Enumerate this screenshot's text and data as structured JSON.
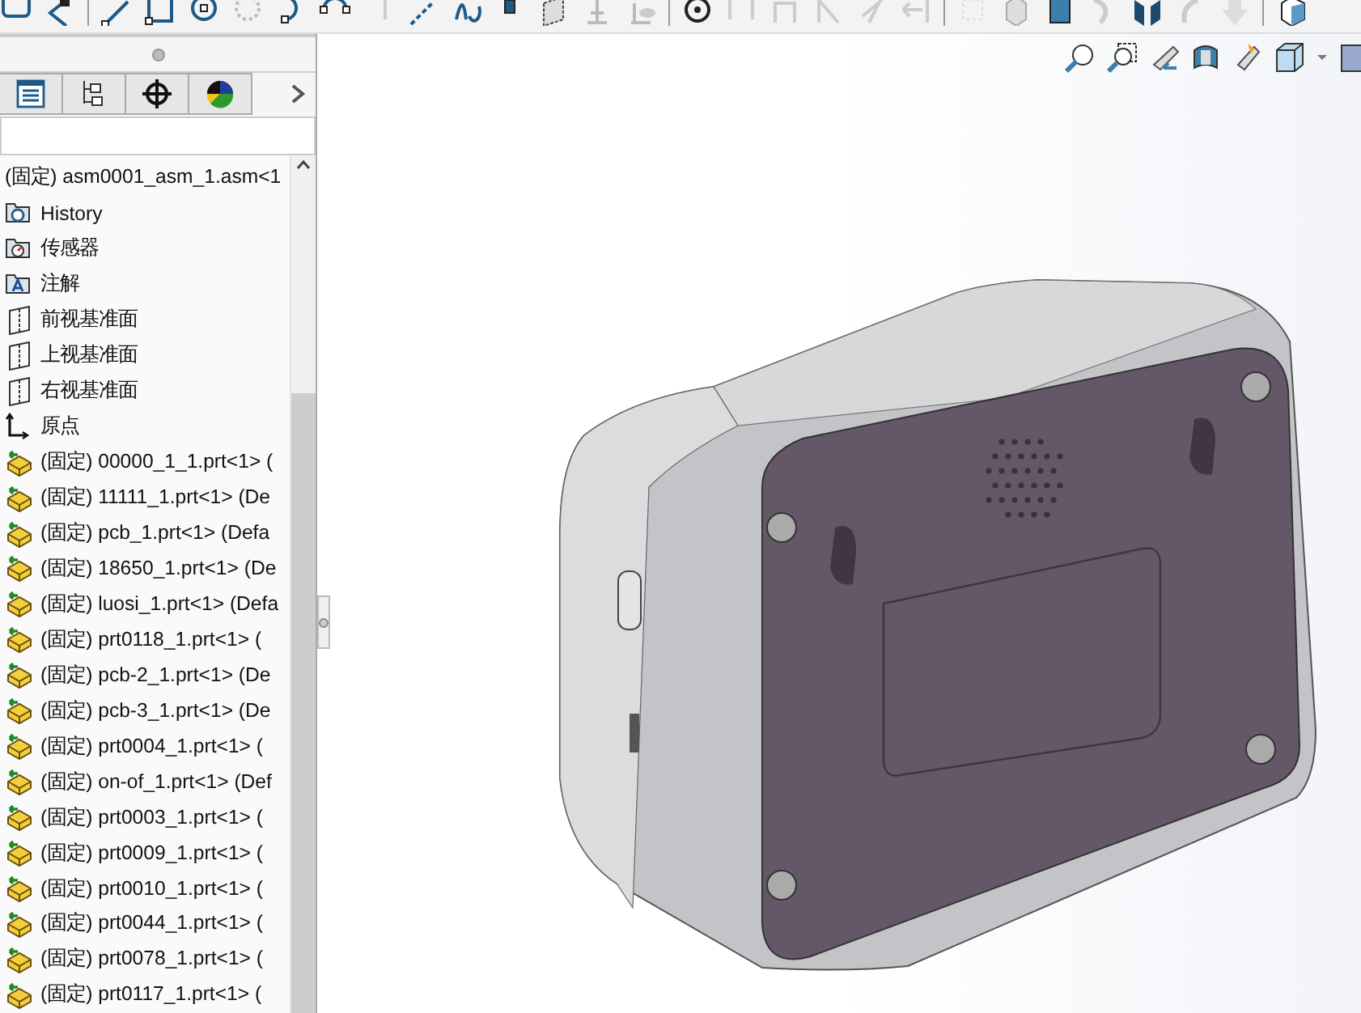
{
  "tree": {
    "items": [
      {
        "kind": "root",
        "label": "(固定) asm0001_asm_1.asm<1"
      },
      {
        "kind": "history",
        "label": "History"
      },
      {
        "kind": "sensor",
        "label": "传感器"
      },
      {
        "kind": "annotation",
        "label": "注解"
      },
      {
        "kind": "plane",
        "label": "前视基准面"
      },
      {
        "kind": "plane",
        "label": "上视基准面"
      },
      {
        "kind": "plane",
        "label": "右视基准面"
      },
      {
        "kind": "origin",
        "label": "原点"
      },
      {
        "kind": "part",
        "label": "(固定) 00000_1_1.prt<1> ("
      },
      {
        "kind": "part",
        "label": "(固定) 11111_1.prt<1> (De"
      },
      {
        "kind": "part",
        "label": "(固定) pcb_1.prt<1> (Defa"
      },
      {
        "kind": "part",
        "label": "(固定) 18650_1.prt<1> (De"
      },
      {
        "kind": "part",
        "label": "(固定) luosi_1.prt<1> (Defa"
      },
      {
        "kind": "part",
        "label": "(固定) prt0118_1.prt<1> ("
      },
      {
        "kind": "part",
        "label": "(固定) pcb-2_1.prt<1> (De"
      },
      {
        "kind": "part",
        "label": "(固定) pcb-3_1.prt<1> (De"
      },
      {
        "kind": "part",
        "label": "(固定) prt0004_1.prt<1> ("
      },
      {
        "kind": "part",
        "label": "(固定) on-of_1.prt<1> (Def"
      },
      {
        "kind": "part",
        "label": "(固定) prt0003_1.prt<1> ("
      },
      {
        "kind": "part",
        "label": "(固定) prt0009_1.prt<1> ("
      },
      {
        "kind": "part",
        "label": "(固定) prt0010_1.prt<1> ("
      },
      {
        "kind": "part",
        "label": "(固定) prt0044_1.prt<1> ("
      },
      {
        "kind": "part",
        "label": "(固定) prt0078_1.prt<1> ("
      },
      {
        "kind": "part",
        "label": "(固定) prt0117_1.prt<1> ("
      }
    ]
  }
}
